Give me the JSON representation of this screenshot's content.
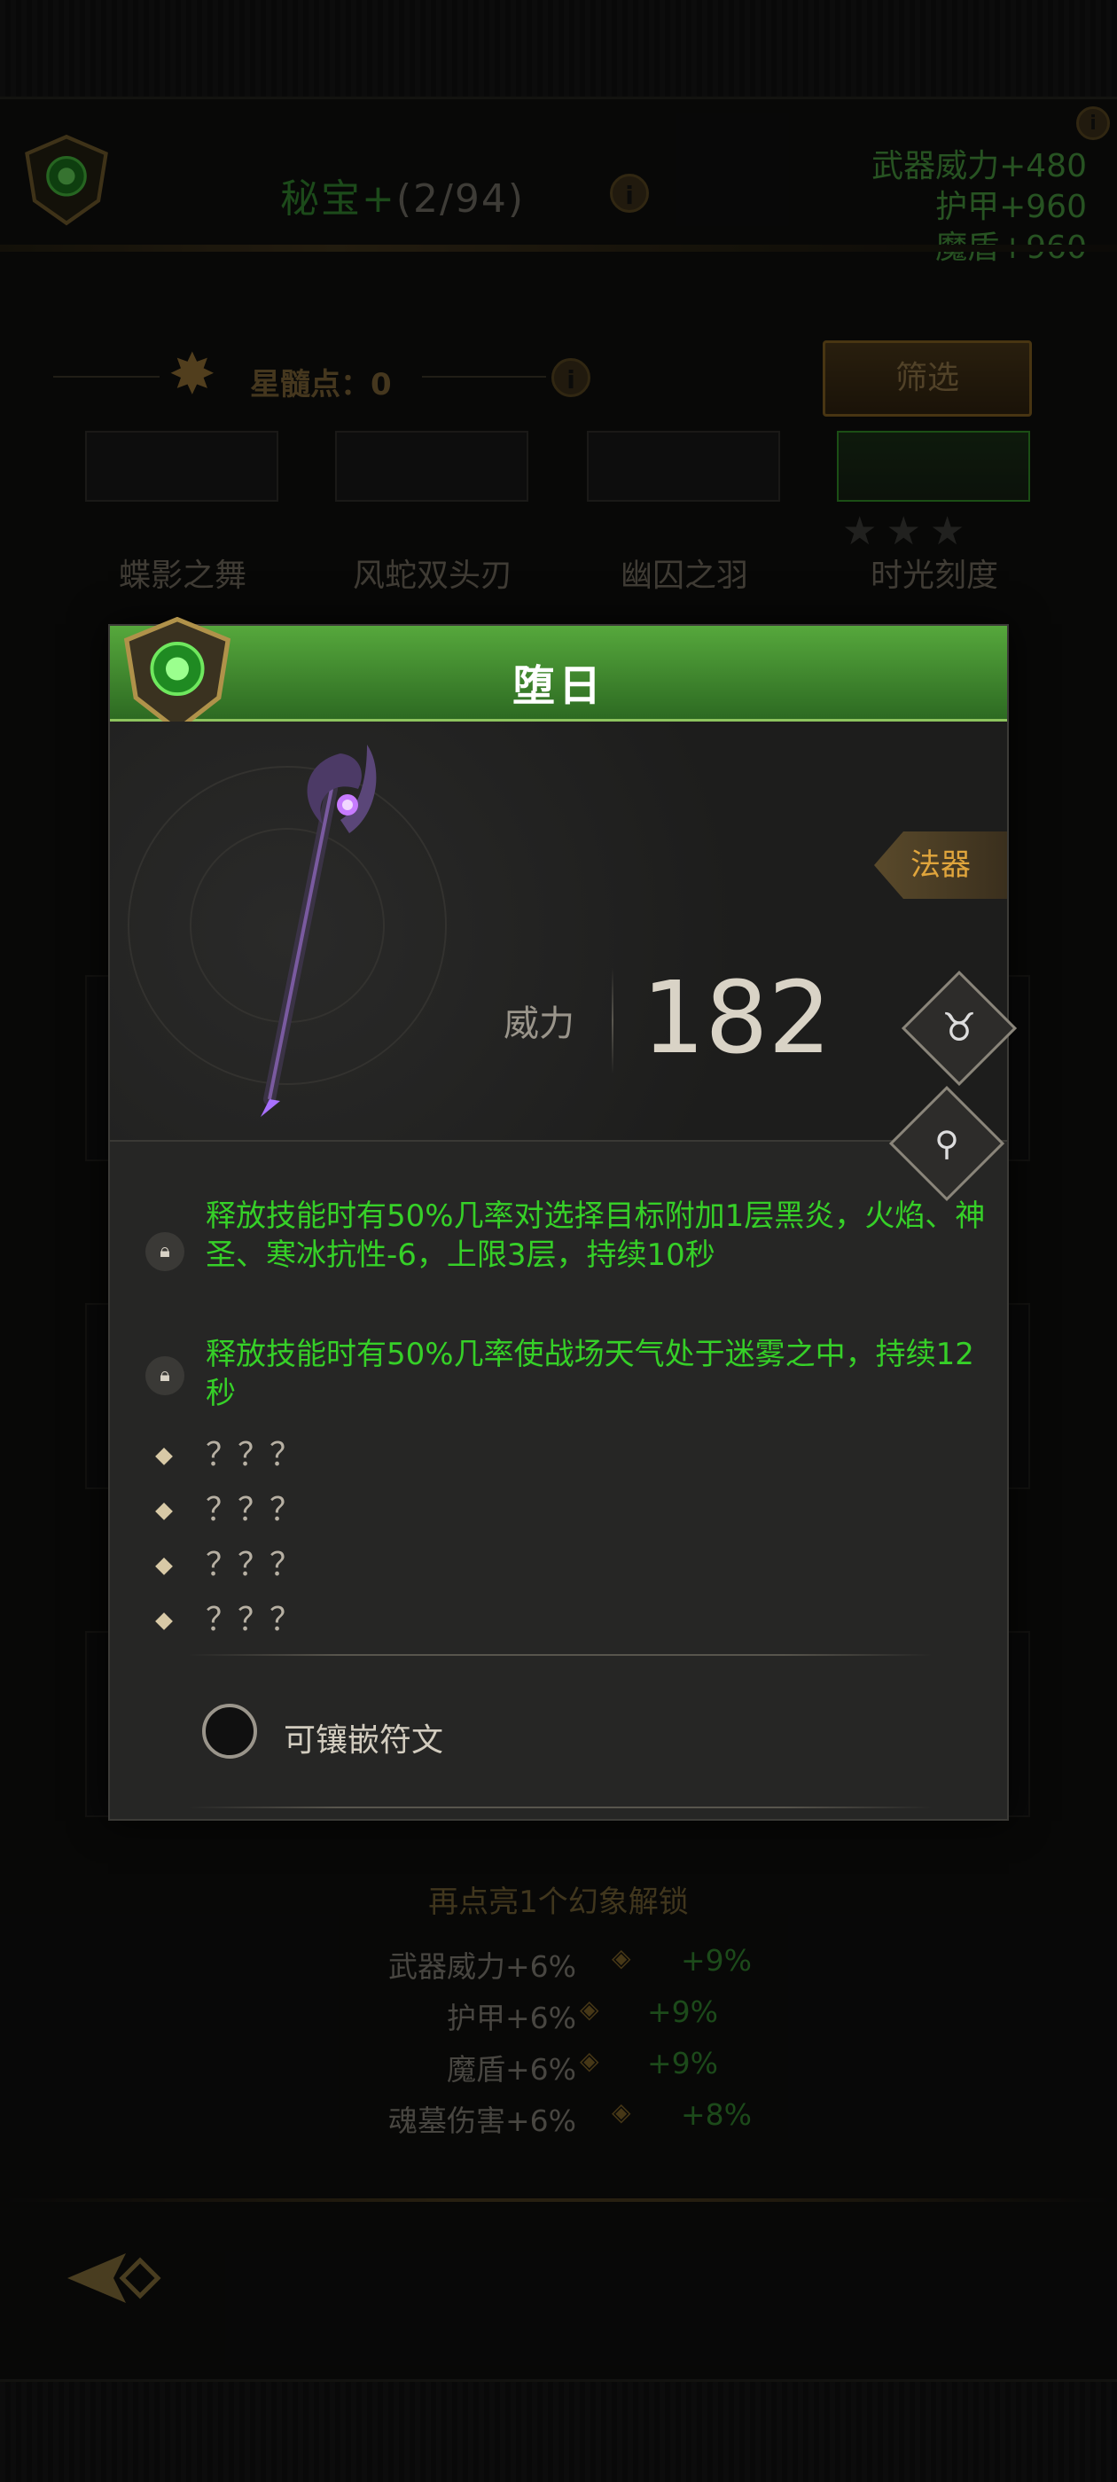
{
  "header": {
    "title": "秘宝+",
    "count": "(2/94)",
    "stats": [
      "武器威力+480",
      "护甲+960",
      "魔盾+960"
    ]
  },
  "star_marrow": {
    "label": "星髓点：0"
  },
  "filter_button": {
    "label": "筛选"
  },
  "collection": {
    "items": [
      {
        "name": "蝶影之舞"
      },
      {
        "name": "风蛇双头刃"
      },
      {
        "name": "幽囚之羽"
      },
      {
        "name": "时光刻度"
      }
    ],
    "selected_stars": "★★★"
  },
  "modal": {
    "title": "堕日",
    "type_tag": "法器",
    "power_label": "威力",
    "power_value": "182",
    "affixes": [
      "释放技能时有50%几率对选择目标附加1层黑炎，火焰、神圣、寒冰抗性-6，上限3层，持续10秒",
      "释放技能时有50%几率使战场天气处于迷雾之中，持续12秒"
    ],
    "unknown_affixes": [
      "？？？",
      "？？？",
      "？？？",
      "？？？"
    ],
    "socket_label": "可镶嵌符文",
    "icons": [
      "bull-skull-icon",
      "magnifier-icon",
      "lock-icon"
    ]
  },
  "unlock": {
    "title": "再点亮1个幻象解锁",
    "rows": [
      {
        "label": "武器威力+6%",
        "value": "+9%"
      },
      {
        "label": "护甲+6%",
        "value": "+9%"
      },
      {
        "label": "魔盾+6%",
        "value": "+9%"
      },
      {
        "label": "魂墓伤害+6%",
        "value": "+8%"
      }
    ]
  },
  "colors": {
    "accent_green": "#3fa43a",
    "gold": "#a07628",
    "affix_green": "#36d028"
  }
}
